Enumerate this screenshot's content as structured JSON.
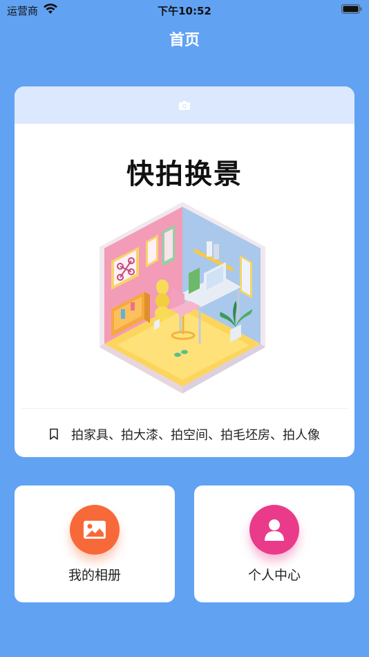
{
  "status_bar": {
    "carrier": "运营商",
    "time": "下午10:52"
  },
  "nav": {
    "title": "首页"
  },
  "hero": {
    "title": "快拍换景",
    "tags": "拍家具、拍大漆、拍空间、拍毛坯房、拍人像",
    "camera_icon": "camera-icon",
    "bookmark_icon": "bookmark-icon"
  },
  "features": [
    {
      "label": "我的相册",
      "icon": "photo-album-icon",
      "color": "#f8693a"
    },
    {
      "label": "个人中心",
      "icon": "user-icon",
      "color": "#ea3b8a"
    }
  ],
  "colors": {
    "background": "#61a2f3",
    "hero_header": "#dbe8fd"
  }
}
